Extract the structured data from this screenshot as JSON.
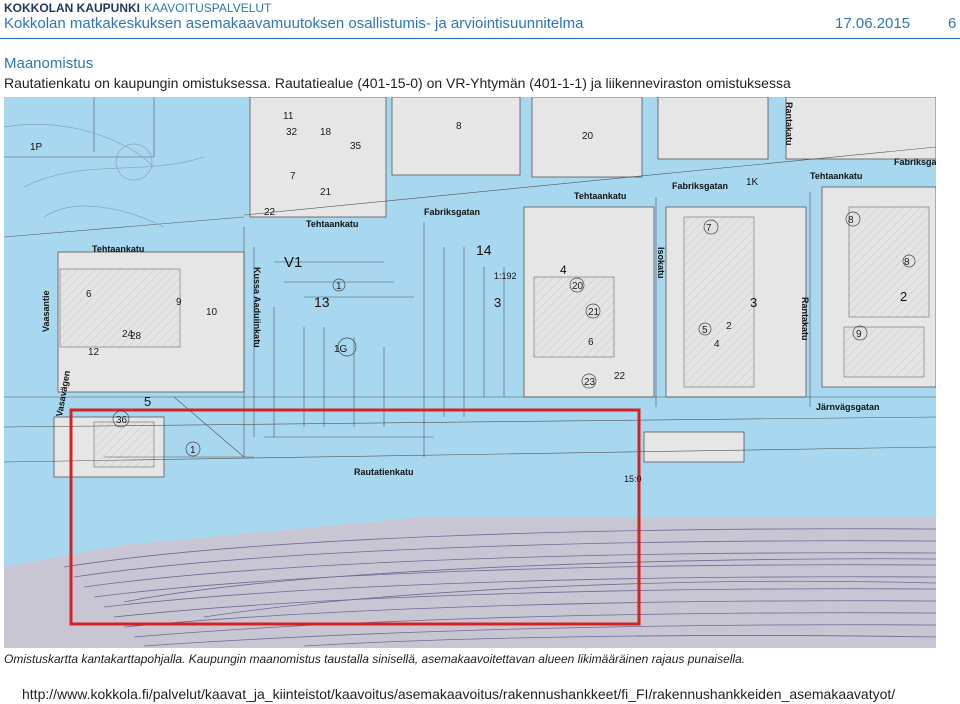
{
  "header": {
    "org_name": "KOKKOLAN KAUPUNKI",
    "org_unit": "KAAVOITUSPALVELUT",
    "doc_title": "Kokkolan matkakeskuksen asemakaavamuutoksen osallistumis- ja arviointisuunnitelma",
    "date": "17.06.2015",
    "page_number": "6"
  },
  "section": {
    "title": "Maanomistus",
    "body": "Rautatienkatu on kaupungin omistuksessa. Rautatiealue (401-15-0) on VR-Yhtymän (401-1-1) ja liikenneviraston omistuksessa"
  },
  "map": {
    "colors": {
      "city_owned": "#a8d8f0",
      "private": "#e6e6e6",
      "rail": "#c4c0d0",
      "outline": "#d22222",
      "lines": "#555555"
    },
    "streets": {
      "tehtaankatu_1": "Tehtaankatu",
      "tehtaankatu_2": "Tehtaankatu",
      "tehtaankatu_3": "Tehtaankatu",
      "tehtaankatu_4": "Tehtaankatu",
      "fabriksgatan_1": "Fabriksgatan",
      "fabriksgatan_2": "Fabriksgatan",
      "fabriksgatan_3": "Fabriksgatan",
      "rautatienkatu": "Rautatienkatu",
      "jarnvagsgatan": "Järnvägsgatan",
      "kussa": "Kussa Aaduiinkatu",
      "isokatu": "Isokatu",
      "rantakatu_1": "Rantakatu",
      "rantakatu_2": "Rantakatu",
      "vaasantie": "Vaasantie",
      "vasavagen": "Vasavägen"
    },
    "zones": {
      "v1": "V1",
      "z13": "13",
      "z14": "14",
      "z1192": "1:192",
      "z4": "4",
      "z3a": "3",
      "z3b": "3",
      "z2": "2",
      "z5": "5",
      "z1g": "1G",
      "z1p": "1P",
      "z1k": "1K",
      "z15": "15:0"
    },
    "parcels": {
      "p11": "11",
      "p32": "32",
      "p18": "18",
      "p35": "35",
      "p8a": "8",
      "p20a": "20",
      "p7a": "7",
      "p21": "21",
      "p22": "22",
      "p6a": "6",
      "p9a": "9",
      "p10": "10",
      "p12": "12",
      "p24": "24",
      "p28": "28",
      "p36": "36",
      "p1a": "1",
      "p1b": "1",
      "p20b": "20",
      "p21b": "21",
      "p6b": "6",
      "p23": "23",
      "p22b": "22",
      "p7b": "7",
      "p8b": "8",
      "p5a": "5",
      "p2a": "2",
      "p4a": "4",
      "p9b": "9",
      "p8c": "8"
    }
  },
  "caption": "Omistuskartta kantakarttapohjalla. Kaupungin maanomistus taustalla sinisellä, asemakaavoitettavan alueen likimääräinen rajaus punaisella.",
  "footer_url": "http://www.kokkola.fi/palvelut/kaavat_ja_kiinteistot/kaavoitus/asemakaavoitus/rakennushankkeet/fi_FI/rakennushankkeiden_asemakaavatyot/"
}
